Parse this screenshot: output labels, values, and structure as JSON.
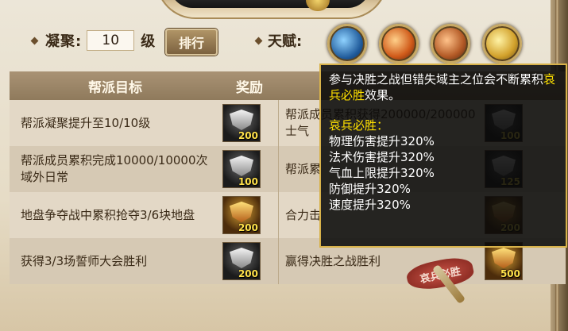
{
  "level": {
    "label": "凝聚:",
    "value": "10",
    "unit": "级",
    "rank_button": "排行"
  },
  "talent": {
    "label": "天赋:",
    "icons": [
      "axe-icon",
      "flame-emblem-icon",
      "fist-icon",
      "golden-crest-icon"
    ]
  },
  "table": {
    "headers": {
      "goal": "帮派目标",
      "reward": "奖励"
    },
    "rows": [
      {
        "goal": "帮派凝聚提升至10/10级",
        "reward_count": "200",
        "reward_tier": "silver",
        "goal2": "帮派成员累积获得200000/200000士气",
        "reward2_count": "100",
        "reward2_tier": "silver"
      },
      {
        "goal": "帮派成员累积完成10000/10000次域外日常",
        "reward_count": "100",
        "reward_tier": "silver",
        "goal2": "帮派累",
        "reward2_count": "125",
        "reward2_tier": "silver"
      },
      {
        "goal": "地盘争夺战中累积抢夺3/6块地盘",
        "reward_count": "200",
        "reward_tier": "gold",
        "goal2": "合力击",
        "reward2_count": "200",
        "reward2_tier": "gold"
      },
      {
        "goal": "获得3/3场誓师大会胜利",
        "reward_count": "200",
        "reward_tier": "silver",
        "goal2": "赢得决胜之战胜利",
        "reward2_count": "500",
        "reward2_tier": "gold"
      }
    ]
  },
  "stamp_text": "哀兵必胜",
  "tooltip": {
    "desc_part1": "参与决胜之战但错失域主之位会不断累积",
    "desc_highlight": "哀兵必胜",
    "desc_part2": "效果。",
    "title": "哀兵必胜：",
    "stats": [
      "物理伤害提升320%",
      "法术伤害提升320%",
      "气血上限提升320%",
      "防御提升320%",
      "速度提升320%"
    ]
  }
}
